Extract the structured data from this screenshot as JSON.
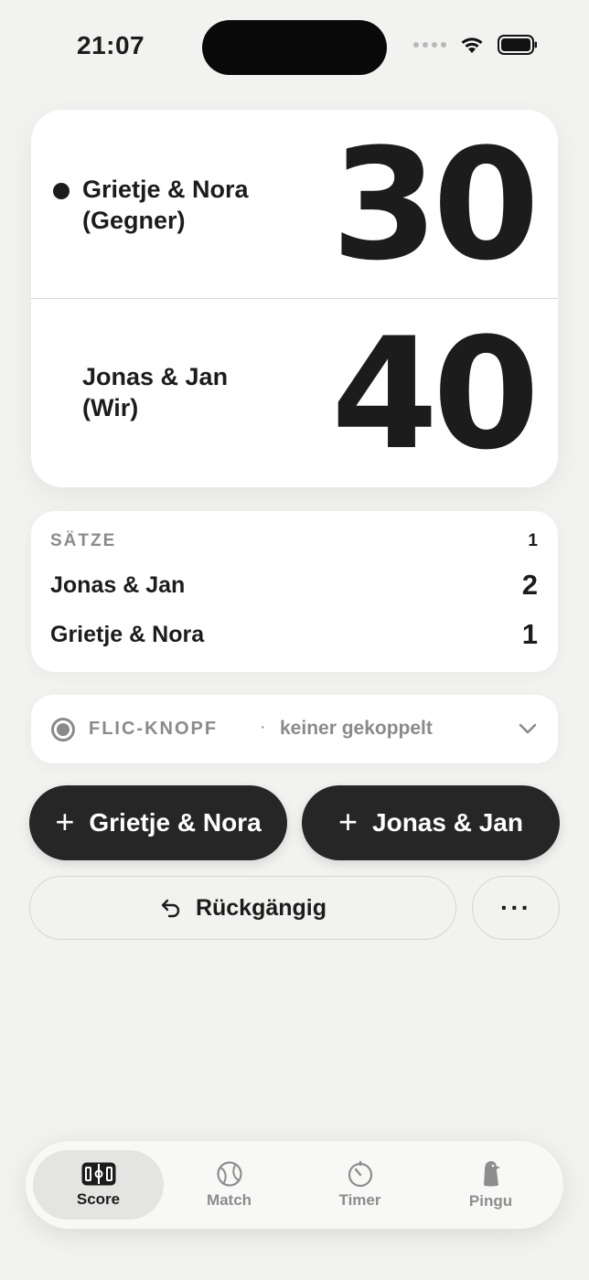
{
  "status_bar": {
    "time": "21:07"
  },
  "score": {
    "teams": [
      {
        "name": "Grietje & Nora",
        "role": "(Gegner)",
        "points": "30",
        "serving": true
      },
      {
        "name": "Jonas & Jan",
        "role": "(Wir)",
        "points": "40",
        "serving": false
      }
    ]
  },
  "sets": {
    "header": "SÄTZE",
    "column": "1",
    "rows": [
      {
        "team": "Jonas & Jan",
        "value": "2"
      },
      {
        "team": "Grietje & Nora",
        "value": "1"
      }
    ]
  },
  "flic": {
    "label": "FLIC-KNOPF",
    "separator": "·",
    "status": "keiner gekoppelt"
  },
  "actions": {
    "point_left": "Grietje & Nora",
    "point_right": "Jonas & Jan",
    "undo": "Rückgängig",
    "more": "···"
  },
  "tabs": [
    {
      "label": "Score",
      "icon": "court-icon",
      "active": true
    },
    {
      "label": "Match",
      "icon": "tennis-ball-icon",
      "active": false
    },
    {
      "label": "Timer",
      "icon": "timer-icon",
      "active": false
    },
    {
      "label": "Pingu",
      "icon": "penguin-icon",
      "active": false
    }
  ],
  "colors": {
    "background": "#f2f2f0",
    "card": "#ffffff",
    "primary_button": "#262626",
    "muted_text": "#8a8a8a"
  }
}
